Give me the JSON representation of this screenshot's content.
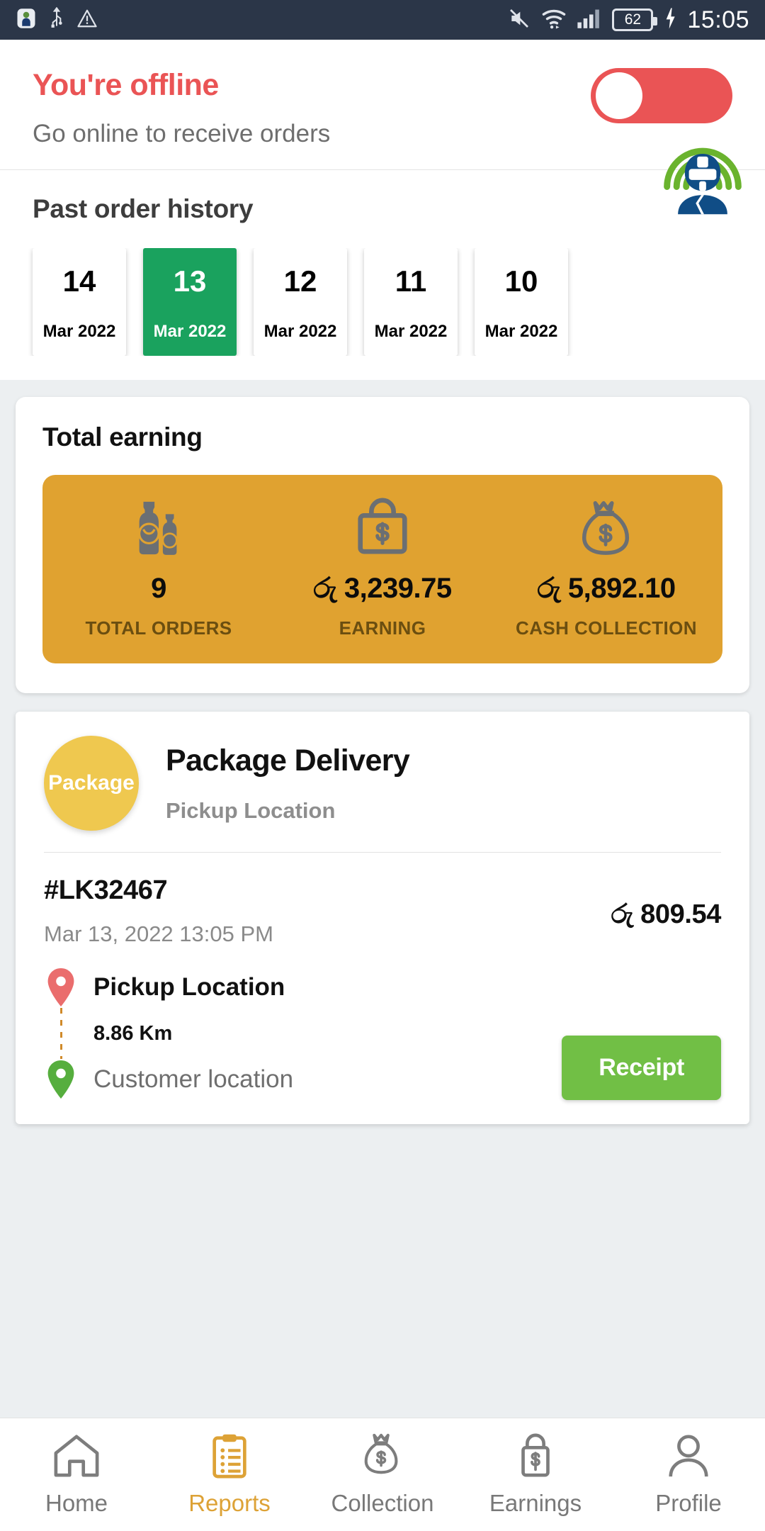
{
  "statusbar": {
    "time": "15:05",
    "battery_level": "62",
    "icons": [
      "android-robot-icon",
      "usb-icon",
      "warning-icon",
      "mute-icon",
      "wifi-icon",
      "signal-icon",
      "battery-icon",
      "charging-bolt-icon"
    ]
  },
  "header": {
    "status_title": "You're offline",
    "status_subtitle": "Go online to receive orders",
    "toggle_state": "off",
    "offline_color": "#ea5455"
  },
  "history": {
    "title": "Past order history",
    "dates": [
      {
        "day": "14",
        "month_year": "Mar 2022",
        "selected": false
      },
      {
        "day": "13",
        "month_year": "Mar 2022",
        "selected": true
      },
      {
        "day": "12",
        "month_year": "Mar 2022",
        "selected": false
      },
      {
        "day": "11",
        "month_year": "Mar 2022",
        "selected": false
      },
      {
        "day": "10",
        "month_year": "Mar 2022",
        "selected": false
      }
    ],
    "selected_color": "#1aa25e"
  },
  "earnings": {
    "title": "Total earning",
    "box_color": "#e0a230",
    "stats": [
      {
        "icon": "bottles-icon",
        "value": "9",
        "label": "TOTAL ORDERS"
      },
      {
        "icon": "shopping-bag-dollar-icon",
        "value": "රු 3,239.75",
        "label": "EARNING"
      },
      {
        "icon": "money-bag-icon",
        "value": "රු 5,892.10",
        "label": "CASH COLLECTION"
      }
    ]
  },
  "order": {
    "badge_text": "Package",
    "kind": "Package Delivery",
    "subtitle": "Pickup Location",
    "order_id": "#LK32467",
    "datetime": "Mar 13, 2022 13:05 PM",
    "price": "රු 809.54",
    "pickup_label": "Pickup Location",
    "distance": "8.86 Km",
    "customer_label": "Customer location",
    "receipt_label": "Receipt",
    "badge_color": "#efc84f",
    "receipt_color": "#71bf45",
    "pickup_pin_color": "#ea6d6d",
    "customer_pin_color": "#56ae3e"
  },
  "bottomnav": {
    "active_color": "#dda236",
    "items": [
      {
        "label": "Home",
        "icon": "home-icon",
        "active": false
      },
      {
        "label": "Reports",
        "icon": "clipboard-icon",
        "active": true
      },
      {
        "label": "Collection",
        "icon": "money-bag-icon",
        "active": false
      },
      {
        "label": "Earnings",
        "icon": "shopping-bag-dollar-icon",
        "active": false
      },
      {
        "label": "Profile",
        "icon": "person-icon",
        "active": false
      }
    ]
  }
}
